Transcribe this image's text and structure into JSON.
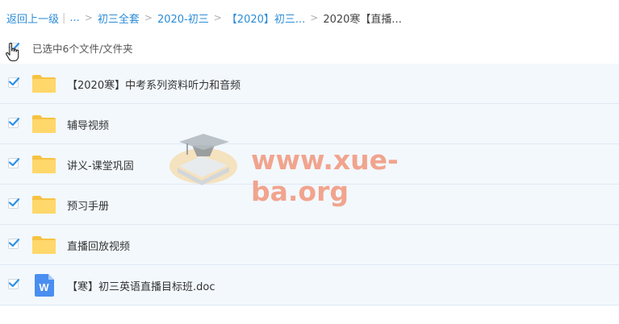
{
  "breadcrumb": {
    "back": "返回上一级",
    "ellipsis": "...",
    "items": [
      "初三全套",
      "2020-初三",
      "【2020】初三..."
    ],
    "current": "2020寒【直播..."
  },
  "selection": {
    "status": "已选中6个文件/文件夹"
  },
  "files": [
    {
      "name": "【2020寒】中考系列资料听力和音频",
      "type": "folder",
      "checked": true
    },
    {
      "name": "辅导视频",
      "type": "folder",
      "checked": true
    },
    {
      "name": "讲义-课堂巩固",
      "type": "folder",
      "checked": true
    },
    {
      "name": "预习手册",
      "type": "folder",
      "checked": true
    },
    {
      "name": "直播回放视频",
      "type": "folder",
      "checked": true
    },
    {
      "name": "【寒】初三英语直播目标班.doc",
      "type": "word-doc",
      "icon_letter": "W",
      "checked": true
    }
  ],
  "watermark": {
    "text": "www.xue-ba.org"
  },
  "colors": {
    "link": "#2b8cd8",
    "check": "#2a8fe6",
    "row_bg": "#f3f8fd",
    "folder": "#ffd76a",
    "word": "#4a8ef0",
    "watermark": "#f08c6e"
  }
}
